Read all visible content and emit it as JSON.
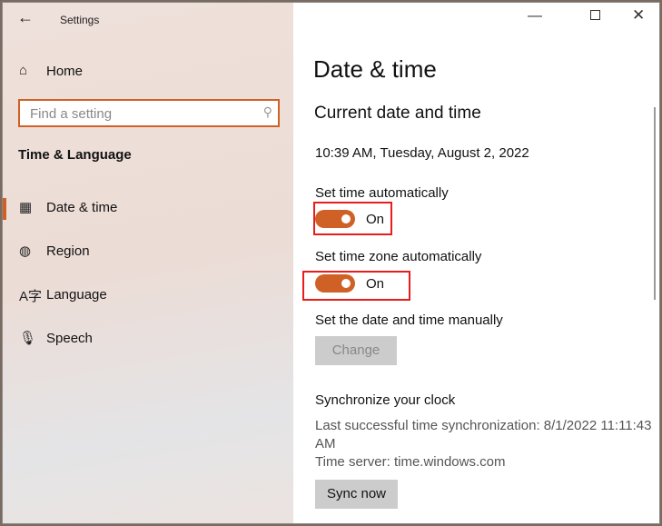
{
  "window": {
    "title": "Settings"
  },
  "sidebar": {
    "home": "Home",
    "search_placeholder": "Find a setting",
    "section": "Time & Language",
    "items": [
      {
        "label": "Date & time"
      },
      {
        "label": "Region"
      },
      {
        "label": "Language"
      },
      {
        "label": "Speech"
      }
    ]
  },
  "main": {
    "title": "Date & time",
    "subtitle": "Current date and time",
    "current": "10:39 AM, Tuesday, August 2, 2022",
    "auto_time_label": "Set time automatically",
    "auto_time_state": "On",
    "auto_zone_label": "Set time zone automatically",
    "auto_zone_state": "On",
    "manual_label": "Set the date and time manually",
    "change_button": "Change",
    "sync_heading": "Synchronize your clock",
    "last_sync": "Last successful time synchronization: 8/1/2022 11:11:43",
    "last_sync_cont": "AM",
    "time_server": "Time server: time.windows.com",
    "sync_button": "Sync now"
  },
  "colors": {
    "accent": "#cf6127",
    "highlight": "#e81c1c"
  }
}
